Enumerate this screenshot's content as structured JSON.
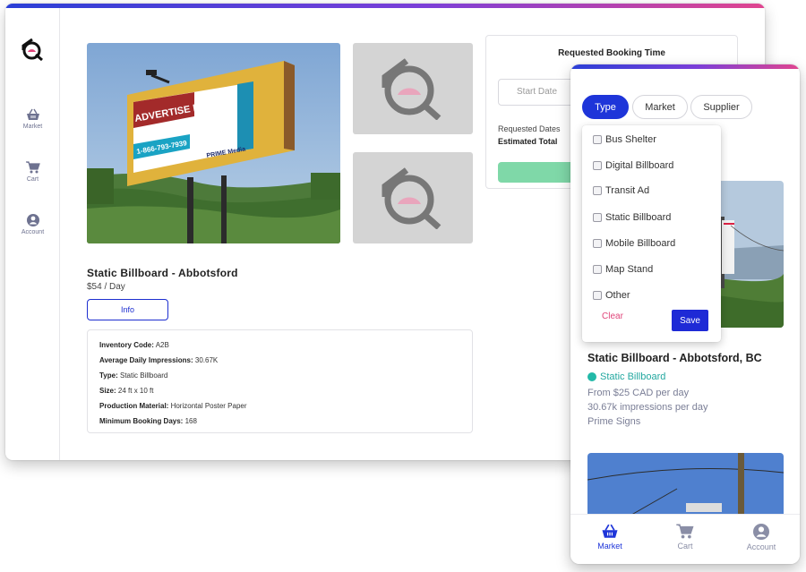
{
  "sidebar": {
    "items": [
      {
        "label": "Market",
        "icon": "basket-icon"
      },
      {
        "label": "Cart",
        "icon": "cart-icon"
      },
      {
        "label": "Account",
        "icon": "account-icon"
      }
    ]
  },
  "listing": {
    "billboard_headline": "ADVERTISE HERE",
    "billboard_phone": "1-866-793-7939",
    "billboard_brand": "PRIME Media",
    "title": "Static Billboard - Abbotsford",
    "price": "$54 / Day",
    "info_label": "Info",
    "details": [
      {
        "label": "Inventory Code:",
        "value": "A2B"
      },
      {
        "label": "Average Daily Impressions:",
        "value": "30.67K"
      },
      {
        "label": "Type:",
        "value": "Static Billboard"
      },
      {
        "label": "Size:",
        "value": "24 ft x 10 ft"
      },
      {
        "label": "Production Material:",
        "value": "Horizontal Poster Paper"
      },
      {
        "label": "Minimum Booking Days:",
        "value": "168"
      }
    ]
  },
  "booking": {
    "title": "Requested Booking Time",
    "start_placeholder": "Start Date",
    "requested_dates": "Requested Dates",
    "estimated_total": "Estimated Total"
  },
  "mobile": {
    "chips": [
      "Type",
      "Market",
      "Supplier"
    ],
    "active_chip": "Type",
    "filter_options": [
      "Bus Shelter",
      "Digital Billboard",
      "Transit Ad",
      "Static Billboard",
      "Mobile Billboard",
      "Map Stand",
      "Other"
    ],
    "clear_label": "Clear",
    "save_label": "Save",
    "card": {
      "title": "Static Billboard - Abbotsford, BC",
      "type": "Static Billboard",
      "price": "From $25 CAD per day",
      "impressions": "30.67k impressions per day",
      "supplier": "Prime Signs"
    },
    "nav": [
      {
        "label": "Market",
        "icon": "basket-icon",
        "active": true
      },
      {
        "label": "Cart",
        "icon": "cart-icon",
        "active": false
      },
      {
        "label": "Account",
        "icon": "account-icon",
        "active": false
      }
    ]
  },
  "colors": {
    "accent": "#1e35d9",
    "type_dot": "#23b9a8",
    "clear": "#e0457a",
    "book_button": "#7fd8a8"
  }
}
